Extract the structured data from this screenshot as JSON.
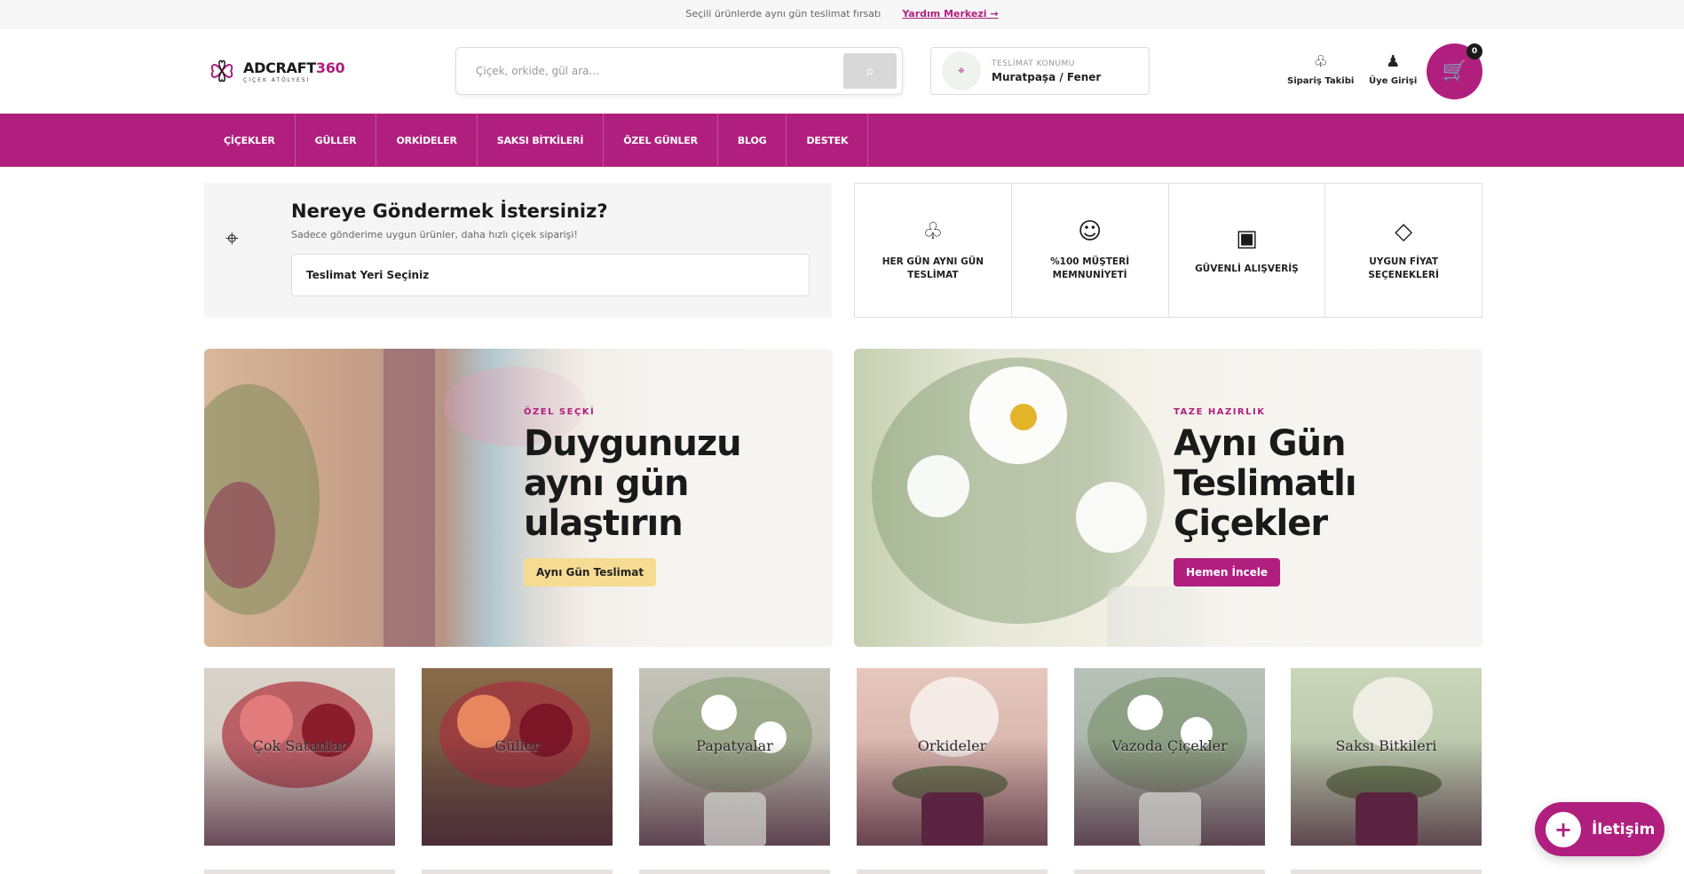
{
  "topbar": {
    "message": "Seçili ürünlerde aynı gün teslimat fırsatı",
    "help_link": "Yardım Merkezi →"
  },
  "logo": {
    "name": "ADCRAFT",
    "number": "360",
    "subtitle": "ÇİÇEK ATÖLYESİ"
  },
  "search": {
    "placeholder": "Çiçek, orkide, gül ara...",
    "button_icon": "search-icon"
  },
  "delivery": {
    "label": "TESLİMAT KONUMU",
    "value": "Muratpaşa / Fener"
  },
  "header_actions": {
    "order_tracking": "Sipariş Takibi",
    "member_login": "Üye Girişi",
    "cart_count": "0"
  },
  "nav": [
    "ÇİÇEKLER",
    "GÜLLER",
    "ORKİDELER",
    "SAKSI BİTKİLERİ",
    "ÖZEL GÜNLER",
    "BLOG",
    "DESTEK"
  ],
  "where": {
    "title": "Nereye Göndermek İstersiniz?",
    "subtitle": "Sadece gönderime uygun ürünler, daha hızlı çiçek siparişi!",
    "select_label": "Teslimat Yeri Seçiniz"
  },
  "features": [
    {
      "icon": "club-icon",
      "glyph": "♧",
      "label": "HER GÜN AYNI GÜN TESLİMAT"
    },
    {
      "icon": "smile-icon",
      "glyph": "☺",
      "label": "%100 MÜŞTERİ MEMNUNİYETİ"
    },
    {
      "icon": "secure-box-icon",
      "glyph": "▣",
      "label": "GÜVENLİ ALIŞVERİŞ"
    },
    {
      "icon": "diamond-icon",
      "glyph": "◇",
      "label": "UYGUN FİYAT SEÇENEKLERİ"
    }
  ],
  "banners": [
    {
      "kicker": "ÖZEL SEÇKİ",
      "title": "Duygunuzu aynı gün ulaştırın",
      "button": "Aynı Gün Teslimat"
    },
    {
      "kicker": "TAZE HAZIRLIK",
      "title": "Aynı Gün Teslimatlı Çiçekler",
      "button": "Hemen İncele"
    }
  ],
  "categories": [
    "Çok Satanlar",
    "Güller",
    "Papatyalar",
    "Orkideler",
    "Vazoda Çiçekler",
    "Saksı Bitkileri"
  ],
  "contact": {
    "label": "İletişim"
  },
  "colors": {
    "brand": "#b01f7e",
    "accent_yellow": "#f6dc93"
  }
}
